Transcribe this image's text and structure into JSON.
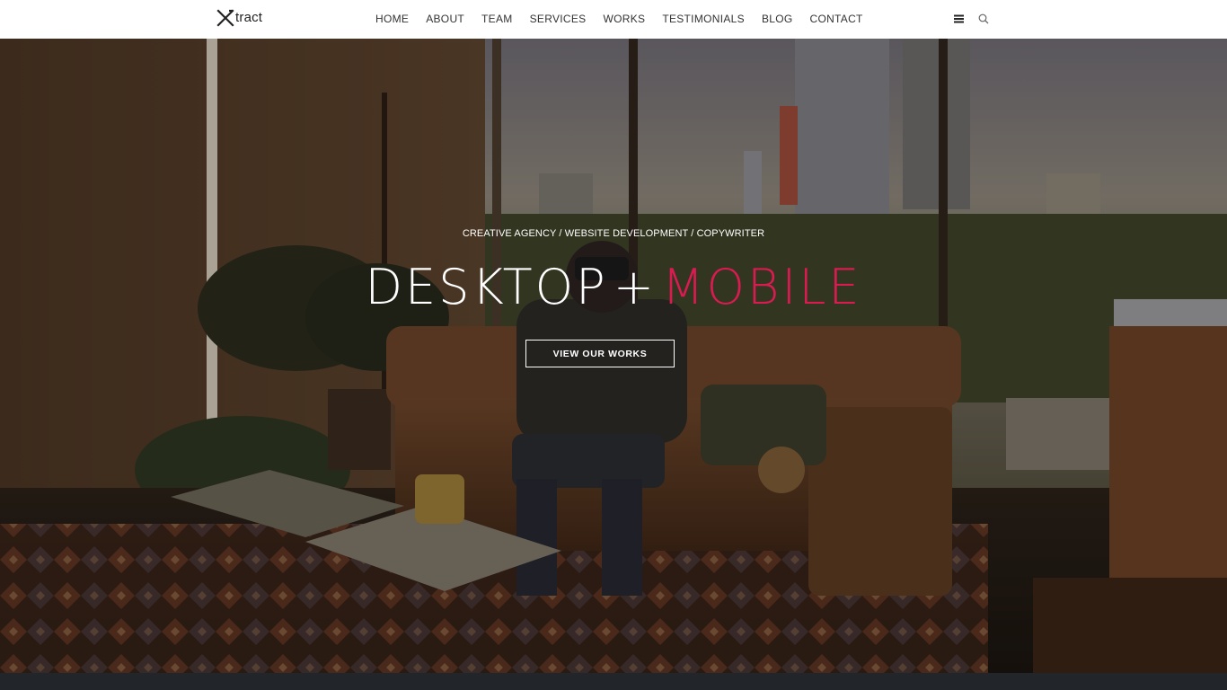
{
  "header": {
    "logo_text": "tract",
    "logo_icon": "x-logo-icon",
    "nav": [
      {
        "label": "HOME"
      },
      {
        "label": "ABOUT"
      },
      {
        "label": "TEAM"
      },
      {
        "label": "SERVICES"
      },
      {
        "label": "WORKS"
      },
      {
        "label": "TESTIMONIALS"
      },
      {
        "label": "BLOG"
      },
      {
        "label": "CONTACT"
      }
    ],
    "tools": {
      "menu_icon": "hamburger-icon",
      "search_icon": "search-icon"
    }
  },
  "hero": {
    "tagline": "CREATIVE AGENCY / WEBSITE DEVELOPMENT / COPYWRITER",
    "headline_part1": "DESKTOP",
    "headline_plus": "+",
    "headline_part2": "MOBILE",
    "cta_label": "VIEW OUR WORKS"
  },
  "colors": {
    "accent": "#d81b50",
    "header_bg": "#ffffff",
    "nav_text": "#333333",
    "footer_bar": "#22262b"
  }
}
